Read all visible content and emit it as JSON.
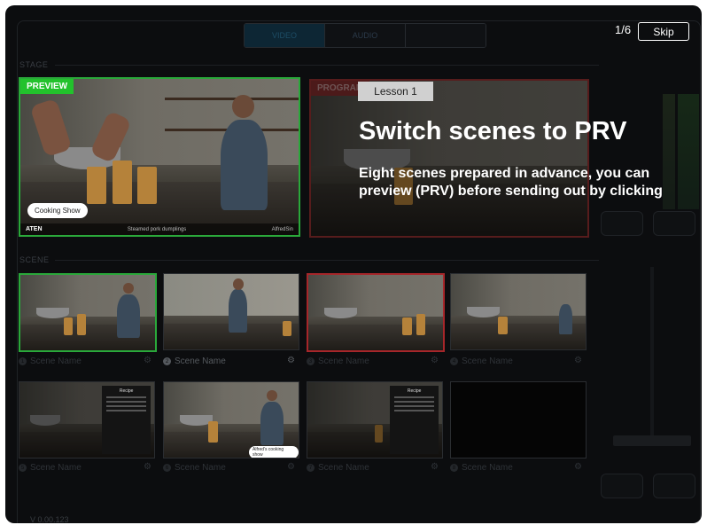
{
  "app": {
    "tabs": [
      {
        "label": "VIDEO",
        "active": true
      },
      {
        "label": "AUDIO",
        "active": false
      },
      {
        "label": "",
        "active": false
      }
    ],
    "top_right_text": "",
    "version": "V 0.00.123"
  },
  "tutorial": {
    "counter": "1/6",
    "skip_label": "Skip",
    "lesson": "Lesson 1",
    "title": "Switch scenes to PRV",
    "body": "Eight scenes prepared in advance, you can preview (PRV) before sending out by clicking"
  },
  "stage": {
    "label": "STAGE",
    "preview": {
      "badge": "PREVIEW",
      "pill": "Cooking Show",
      "bar_left": "ATEN",
      "bar_center": "Steamed pork dumplings",
      "bar_right": "AlfredSin"
    },
    "program": {
      "badge": "PROGRAM"
    }
  },
  "scenes": {
    "label": "SCENE",
    "items": [
      {
        "num": "1",
        "name": "Scene Name",
        "state": "prv"
      },
      {
        "num": "2",
        "name": "Scene Name",
        "state": "normal"
      },
      {
        "num": "3",
        "name": "Scene Name",
        "state": "pgm"
      },
      {
        "num": "4",
        "name": "Scene Name",
        "state": "normal"
      },
      {
        "num": "5",
        "name": "Scene Name",
        "state": "normal"
      },
      {
        "num": "6",
        "name": "Scene Name",
        "state": "normal"
      },
      {
        "num": "7",
        "name": "Scene Name",
        "state": "normal"
      },
      {
        "num": "8",
        "name": "Scene Name",
        "state": "blank"
      }
    ],
    "recipe_title": "Recipe",
    "scene6_pill": "Alfred's cooking show"
  },
  "colors": {
    "preview_green": "#22c22c",
    "program_red": "#a6262a",
    "background": "#0c0d0f"
  }
}
